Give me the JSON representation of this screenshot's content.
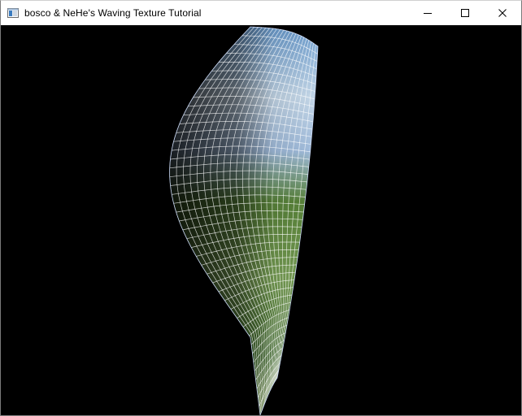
{
  "window": {
    "title": "bosco & NeHe's Waving Texture Tutorial",
    "app_icon": "opengl-window-icon",
    "controls": {
      "minimize_icon": "minimize-icon",
      "maximize_icon": "maximize-icon",
      "close_icon": "close-icon"
    }
  },
  "scene": {
    "description_icon": "waving-textured-mesh",
    "background_color": "#000000",
    "mesh_color": "#ffffff",
    "texture_colors": [
      "#6fa3d8",
      "#cfe3f5",
      "#3f6f2a",
      "#7fa85a",
      "#a9c6e8"
    ]
  }
}
